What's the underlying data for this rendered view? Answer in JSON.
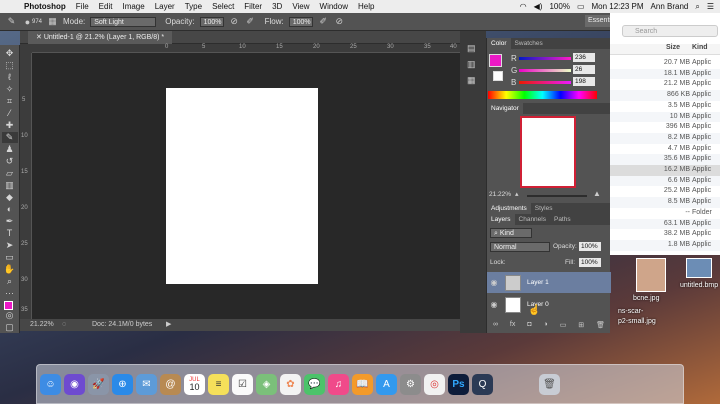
{
  "menubar": {
    "app": "Photoshop",
    "items": [
      "File",
      "Edit",
      "Image",
      "Layer",
      "Type",
      "Select",
      "Filter",
      "3D",
      "View",
      "Window",
      "Help"
    ],
    "battery": "100%",
    "clock": "Mon 12:23 PM",
    "user": "Ann Brand"
  },
  "options": {
    "brush_size": "974",
    "mode_label": "Mode:",
    "mode_value": "Soft Light",
    "opacity_label": "Opacity:",
    "opacity_value": "100%",
    "flow_label": "Flow:",
    "flow_value": "100%",
    "workspace": "Essentials"
  },
  "document": {
    "tab_title": "Untitled-1 @ 21.2% (Layer 1, RGB/8) *",
    "zoom": "21.22%",
    "doc_info": "Doc: 24.1M/0 bytes",
    "ruler_top": [
      "0",
      "5",
      "10",
      "15",
      "20",
      "25",
      "30",
      "35",
      "40"
    ],
    "ruler_left": [
      "5",
      "10",
      "15",
      "20",
      "25",
      "30",
      "35"
    ]
  },
  "color_panel": {
    "tabs": [
      "Color",
      "Swatches"
    ],
    "r_label": "R",
    "g_label": "G",
    "b_label": "B",
    "r": "236",
    "g": "26",
    "b": "198",
    "color": "#ec1ac6"
  },
  "navigator": {
    "title": "Navigator",
    "zoom": "21.22%"
  },
  "adjustments": {
    "tabs": [
      "Adjustments",
      "Styles"
    ]
  },
  "layers": {
    "tabs": [
      "Layers",
      "Channels",
      "Paths"
    ],
    "kind": "Kind",
    "blend": "Normal",
    "opacity_label": "Opacity:",
    "opacity": "100%",
    "lock_label": "Lock:",
    "fill_label": "Fill:",
    "fill": "100%",
    "items": [
      {
        "name": "Layer 1"
      },
      {
        "name": "Layer 0"
      }
    ]
  },
  "finder": {
    "search_placeholder": "Search",
    "col_size": "Size",
    "col_kind": "Kind",
    "rows": [
      {
        "size": "20.7 MB",
        "kind": "Applic"
      },
      {
        "size": "18.1 MB",
        "kind": "Applic"
      },
      {
        "size": "21.2 MB",
        "kind": "Applic"
      },
      {
        "size": "866 KB",
        "kind": "Applic"
      },
      {
        "size": "3.5 MB",
        "kind": "Applic"
      },
      {
        "size": "10 MB",
        "kind": "Applic"
      },
      {
        "size": "396 MB",
        "kind": "Applic"
      },
      {
        "size": "8.2 MB",
        "kind": "Applic"
      },
      {
        "size": "4.7 MB",
        "kind": "Applic"
      },
      {
        "size": "35.6 MB",
        "kind": "Applic"
      },
      {
        "size": "16.2 MB",
        "kind": "Applic"
      },
      {
        "size": "6.6 MB",
        "kind": "Applic"
      },
      {
        "size": "25.2 MB",
        "kind": "Applic"
      },
      {
        "size": "8.5 MB",
        "kind": "Applic"
      },
      {
        "size": "--",
        "kind": "Folder"
      },
      {
        "size": "63.1 MB",
        "kind": "Applic"
      },
      {
        "size": "38.2 MB",
        "kind": "Applic"
      },
      {
        "size": "1.8 MB",
        "kind": "Applic"
      }
    ]
  },
  "desktop": {
    "files": [
      "bcne.jpg",
      "untitled.bmp",
      "ns-scar-",
      "p2-small.jpg"
    ]
  },
  "dock": {
    "items": [
      "finder",
      "siri",
      "launchpad",
      "safari",
      "mail",
      "contacts",
      "calendar",
      "notes",
      "reminders",
      "maps",
      "photos",
      "messages",
      "itunes",
      "ibooks",
      "app-store",
      "system-preferences",
      "chrome",
      "photoshop",
      "quicktime",
      "trash"
    ],
    "calendar_month": "JUL",
    "calendar_day": "10"
  }
}
